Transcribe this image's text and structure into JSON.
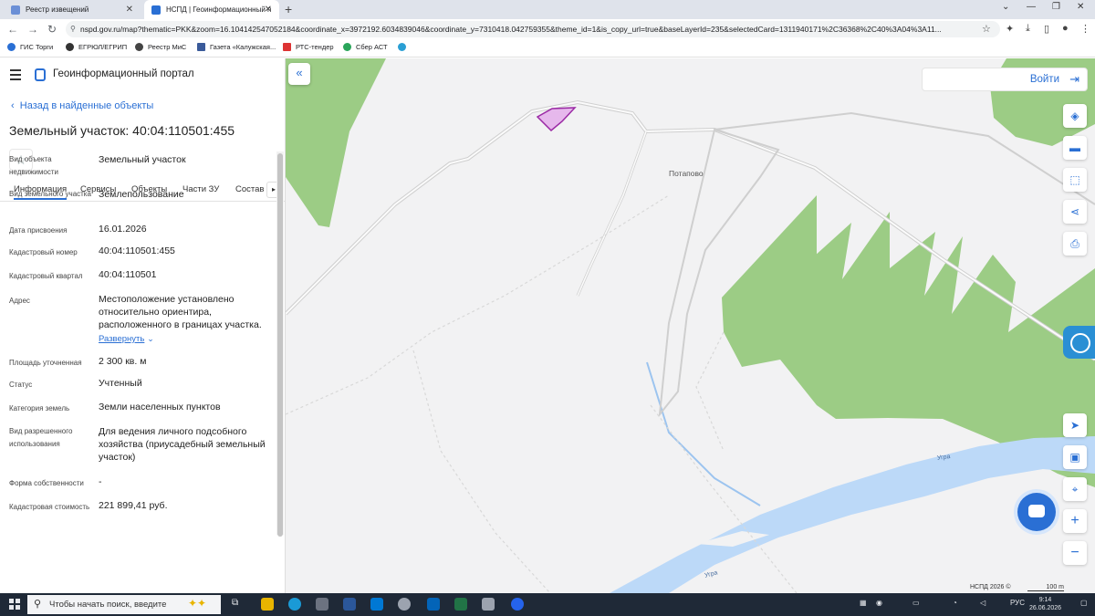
{
  "browser": {
    "tabs": [
      {
        "title": "Реестр извещений",
        "active": false
      },
      {
        "title": "НСПД | Геоинформационный п",
        "active": true
      }
    ],
    "url": "nspd.gov.ru/map?thematic=PKK&zoom=16.104142547052184&coordinate_x=3972192.6034839046&coordinate_y=7310418.042759355&theme_id=1&is_copy_url=true&baseLayerId=235&selectedCard=1311940171%2C36368%2C40%3A04%3A11...",
    "bookmarks": [
      "ГИС Торги",
      "ЕГРЮЛ/ЕГРИП",
      "Реестр МиС",
      "Газета «Калужская...",
      "РТС-тендер",
      "Сбер АСТ"
    ]
  },
  "portal": {
    "title": "Геоинформационный портал",
    "back_link": "Назад в найденные объекты",
    "object_title": "Земельный участок: 40:04:110501:455",
    "tabs": [
      "Информация",
      "Сервисы",
      "Объекты",
      "Части ЗУ",
      "Состав"
    ],
    "properties": [
      {
        "label": "Вид объекта недвижимости",
        "value": "Земельный участок"
      },
      {
        "label": "Вид земельного участка",
        "value": "Землепользование"
      },
      {
        "label": "Дата присвоения",
        "value": "16.01.2026"
      },
      {
        "label": "Кадастровый номер",
        "value": "40:04:110501:455"
      },
      {
        "label": "Кадастровый квартал",
        "value": "40:04:110501"
      },
      {
        "label": "Адрес",
        "value": "Местоположение установлено относительно ориентира, расположенного в границах участка."
      },
      {
        "label": "Площадь уточненная",
        "value": "2 300 кв. м"
      },
      {
        "label": "Статус",
        "value": "Учтенный"
      },
      {
        "label": "Категория земель",
        "value": "Земли населенных пунктов"
      },
      {
        "label": "Вид разрешенного использования",
        "value": "Для ведения личного подсобного хозяйства (приусадебный земельный участок)"
      },
      {
        "label": "Форма собственности",
        "value": "-"
      },
      {
        "label": "Кадастровая стоимость",
        "value": "221 899,41 руб."
      }
    ],
    "expand_label": "Развернуть"
  },
  "map": {
    "login_label": "Войти",
    "village_label": "Потапово",
    "river_label_1": "Угра",
    "river_label_2": "Угра",
    "copyright": "НСПД 2026 ©",
    "scale": "100 m",
    "colors": {
      "forest": "#9ccc85",
      "water": "#bcd9f8",
      "parcel_fill": "#e6b8ec",
      "parcel_stroke": "#9b2aa5",
      "accent": "#2a6fd4"
    }
  },
  "taskbar": {
    "search_placeholder": "Чтобы начать поиск, введите",
    "lang": "РУС",
    "time": "9:14",
    "date": "26.06.2026"
  }
}
